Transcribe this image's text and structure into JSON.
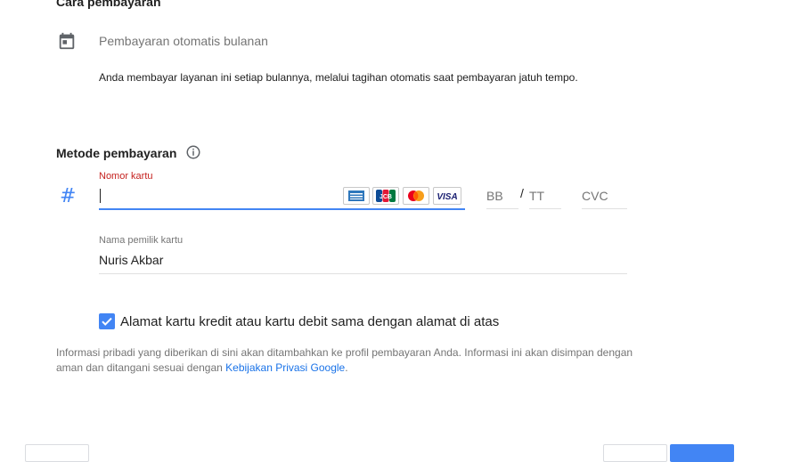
{
  "payment_method_section": {
    "title": "Cara pembayaran",
    "icon": "calendar-icon",
    "option_label": "Pembayaran otomatis bulanan",
    "description": "Anda membayar layanan ini setiap bulannya, melalui tagihan otomatis saat pembayaran jatuh tempo."
  },
  "method_section": {
    "title": "Metode pembayaran",
    "info_icon": "info-icon",
    "card_icon": "hash-icon",
    "card_number": {
      "label": "Nomor kartu",
      "value": "",
      "accepted_cards": [
        "American Express",
        "JCB",
        "MasterCard",
        "VISA"
      ]
    },
    "expiry_month_placeholder": "BB",
    "expiry_separator": "/",
    "expiry_year_placeholder": "TT",
    "cvc_placeholder": "CVC",
    "cardholder": {
      "label": "Nama pemilik kartu",
      "value": "Nuris Akbar"
    }
  },
  "same_address": {
    "checked": true,
    "label": "Alamat kartu kredit atau kartu debit sama dengan alamat di atas"
  },
  "privacy": {
    "text": "Informasi pribadi yang diberikan di sini akan ditambahkan ke profil pembayaran Anda. Informasi ini akan disimpan dengan aman dan ditangani sesuai dengan ",
    "link": "Kebijakan Privasi Google",
    "end": "."
  },
  "colors": {
    "accent": "#4285f4",
    "error_label": "#c5221f",
    "link": "#1a73e8"
  }
}
